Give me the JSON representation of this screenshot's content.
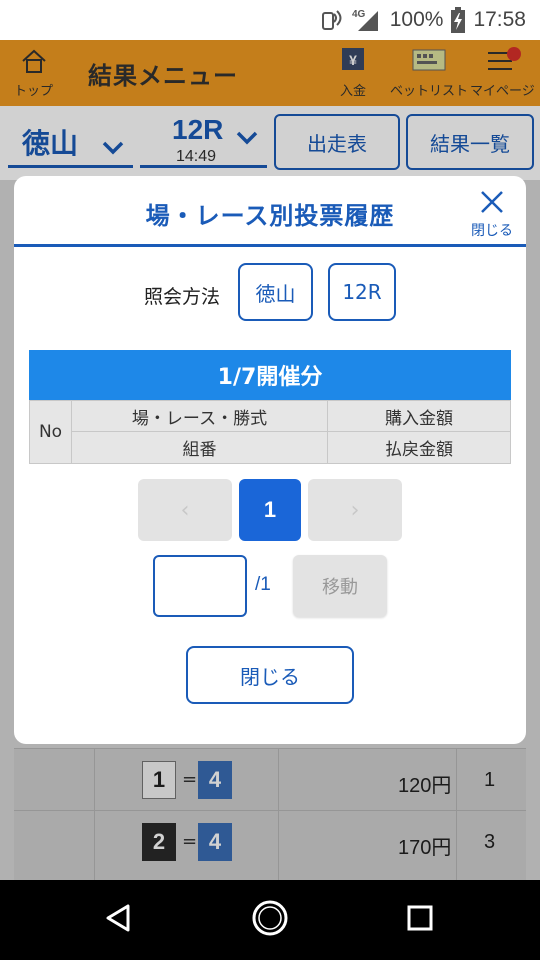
{
  "status_bar": {
    "network": "4G",
    "battery": "100%",
    "time": "17:58"
  },
  "header": {
    "home_label": "トップ",
    "title": "結果メニュー",
    "deposit_label": "入金",
    "betlist_label": "ベットリスト",
    "mypage_label": "マイページ"
  },
  "selectors": {
    "place": "徳山",
    "race": "12R",
    "race_time": "14:49",
    "race_card_label": "出走表",
    "results_label": "結果一覧"
  },
  "background_rows": [
    {
      "first": "1",
      "second": "4",
      "amount": "120円",
      "popularity": "1"
    },
    {
      "first": "2",
      "second": "4",
      "amount": "170円",
      "popularity": "3"
    }
  ],
  "modal": {
    "title": "場・レース別投票履歴",
    "close_icon_label": "閉じる",
    "inquiry_label": "照会方法",
    "inquiry_place": "徳山",
    "inquiry_race": "12R",
    "date_header": "1/7開催分",
    "table": {
      "no": "No",
      "race_type": "場・レース・勝式",
      "purchase": "購入金額",
      "combination": "組番",
      "refund": "払戻金額"
    },
    "pagination": {
      "prev": "‹",
      "current": "1",
      "next": "›",
      "input_value": "",
      "total": "/1",
      "move_label": "移動"
    },
    "close_button": "閉じる"
  },
  "colors": {
    "header_orange": "#ef9a22",
    "primary_blue": "#1a5bb8",
    "date_bar_blue": "#1e88e8",
    "active_page_blue": "#1a66d8"
  }
}
